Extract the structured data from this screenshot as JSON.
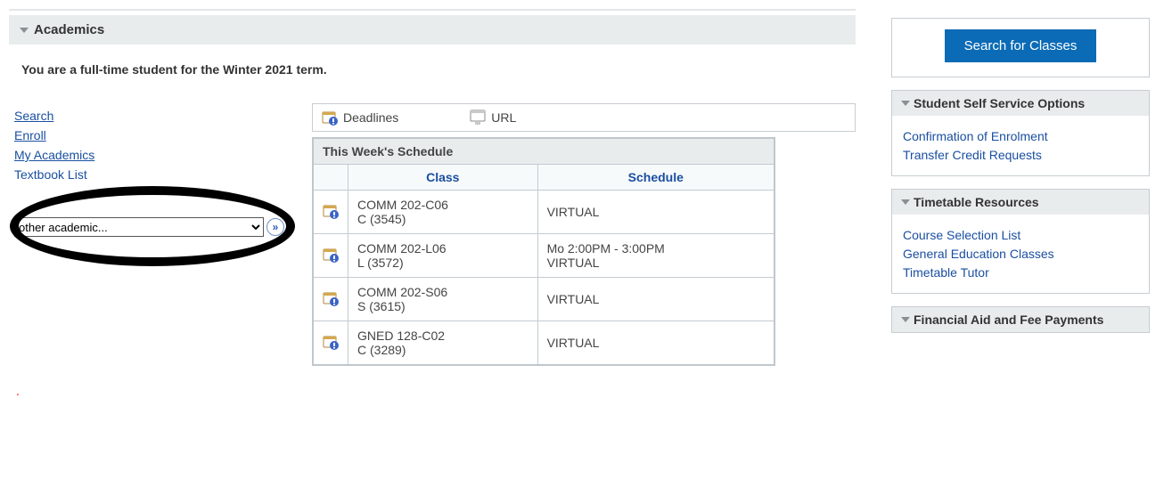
{
  "academics": {
    "title": "Academics",
    "status_msg": "You are a full-time student for the Winter 2021 term.",
    "links": {
      "search": "Search",
      "enroll": "Enroll",
      "my_academics": "My Academics",
      "textbook_list": "Textbook List"
    },
    "dropdown": {
      "selected": "other academic..."
    },
    "legend": {
      "deadlines": "Deadlines",
      "url": "URL"
    },
    "schedule": {
      "title": "This Week's Schedule",
      "col_class": "Class",
      "col_schedule": "Schedule",
      "rows": [
        {
          "class_line1": "COMM 202-C06",
          "class_line2": "C (3545)",
          "sched": "VIRTUAL"
        },
        {
          "class_line1": "COMM 202-L06",
          "class_line2": "L (3572)",
          "sched": "Mo 2:00PM - 3:00PM\nVIRTUAL"
        },
        {
          "class_line1": "COMM 202-S06",
          "class_line2": "S (3615)",
          "sched": "VIRTUAL"
        },
        {
          "class_line1": "GNED 128-C02",
          "class_line2": "C (3289)",
          "sched": "VIRTUAL"
        }
      ]
    }
  },
  "right": {
    "search_btn": "Search for Classes",
    "panels": {
      "self_service": {
        "title": "Student Self Service Options",
        "links": {
          "conf": "Confirmation of Enrolment",
          "tcr": "Transfer Credit Requests"
        }
      },
      "timetable": {
        "title": "Timetable Resources",
        "links": {
          "csl": "Course Selection List",
          "gec": "General Education Classes",
          "tt": "Timetable Tutor"
        }
      },
      "finaid": {
        "title": "Financial Aid and Fee Payments"
      }
    }
  }
}
